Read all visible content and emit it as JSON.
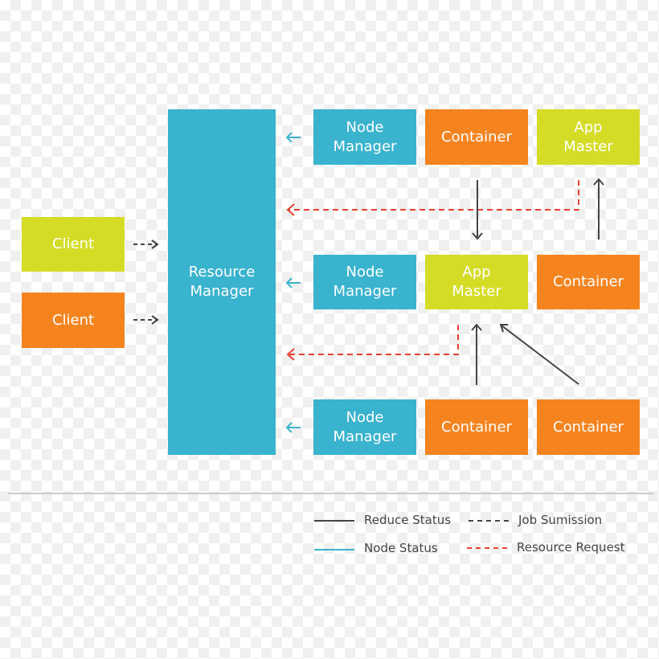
{
  "colors": {
    "node_manager": "#3ab3cf",
    "container": "#f5841f",
    "app_master": "#d4dc26",
    "reduce_status": "#444444",
    "node_status": "#3ab3cf",
    "job_submission": "#444444",
    "resource_request": "#e8402f"
  },
  "clients": [
    "Client",
    "Client"
  ],
  "resource_manager": "Resource\nManager",
  "rows": [
    [
      "Node\nManager",
      "Container",
      "App\nMaster"
    ],
    [
      "Node\nManager",
      "App\nMaster",
      "Container"
    ],
    [
      "Node\nManager",
      "Container",
      "Container"
    ]
  ],
  "legend": {
    "reduce_status": "Reduce Status",
    "node_status": "Node Status",
    "job_submission": "Job Sumission",
    "resource_request": "Resource Request"
  }
}
